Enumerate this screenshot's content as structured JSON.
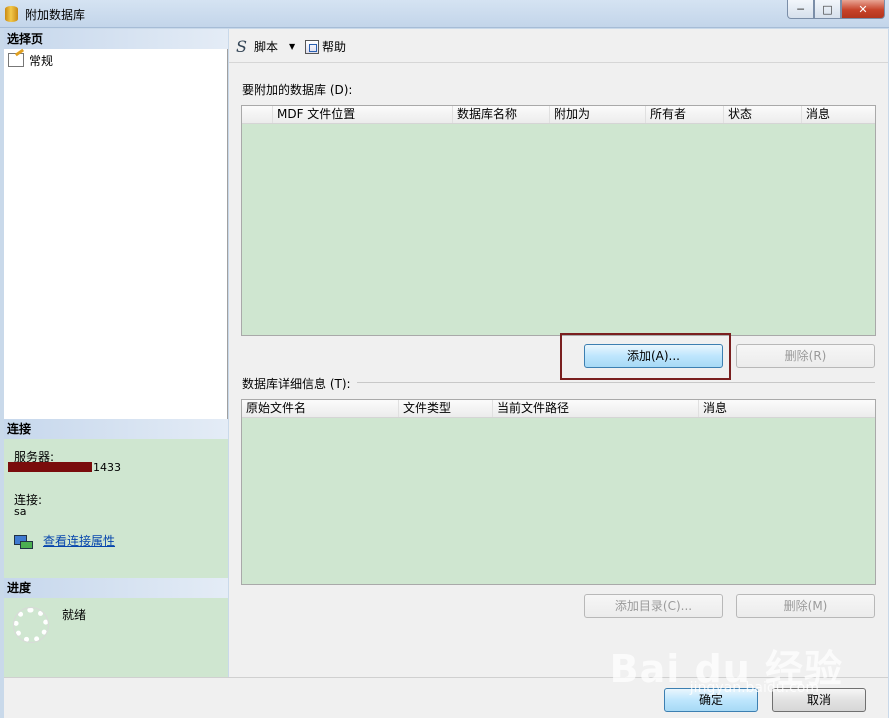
{
  "window": {
    "title": "附加数据库",
    "controls": [
      "minimize-icon",
      "maximize-icon",
      "close-icon"
    ]
  },
  "left_pane": {
    "select_page_heading": "选择页",
    "pages": [
      {
        "label": "常规",
        "icon": "general-page-icon"
      }
    ],
    "connection_heading": "连接",
    "server_label": "服务器:",
    "server_value": "1433",
    "connection_label": "连接:",
    "connection_value": "sa",
    "view_connection_properties": "查看连接属性",
    "progress_heading": "进度",
    "progress_status": "就绪"
  },
  "toolbar": {
    "script_label": "脚本",
    "help_label": "帮助"
  },
  "databases_to_attach": {
    "label": "要附加的数据库 (D):",
    "columns": [
      "MDF 文件位置",
      "数据库名称",
      "附加为",
      "所有者",
      "状态",
      "消息"
    ],
    "rows": []
  },
  "buttons": {
    "add": "添加(A)...",
    "remove": "删除(R)",
    "add_catalog": "添加目录(C)...",
    "remove_detail": "删除(M)",
    "ok": "确定",
    "cancel": "取消"
  },
  "database_details": {
    "label": "数据库详细信息 (T):",
    "columns": [
      "原始文件名",
      "文件类型",
      "当前文件路径",
      "消息"
    ],
    "rows": []
  },
  "watermark": {
    "logo_text": "Bai du 经验",
    "url_text": "jingyan.baidu.com"
  },
  "colors": {
    "grid_background": "#cfe6d0",
    "highlight_border": "#7a1f1f",
    "link": "#0645ad"
  }
}
